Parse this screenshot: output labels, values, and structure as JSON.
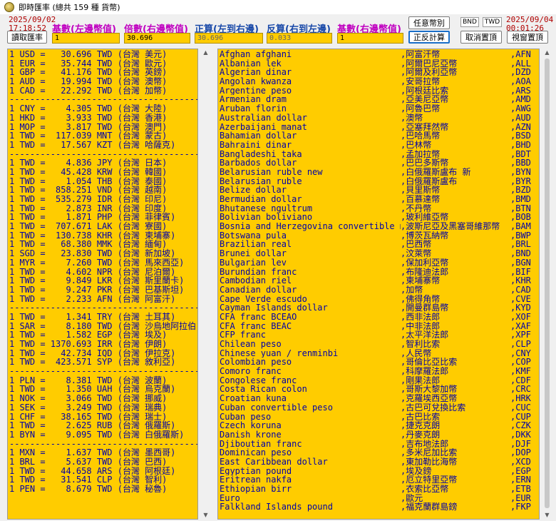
{
  "window": {
    "title": "即時匯率 (總共 159 種 貨幣)"
  },
  "timestamps": {
    "left_date": "2025/09/02",
    "left_time": "17:18:52",
    "right_date": "2025/09/04",
    "right_time": "00:01:26"
  },
  "labels": {
    "base_left": "基數(左邊幣值)",
    "multiplier_right": "倍數(右邊幣值)",
    "forward_calc": "正算(左到右邊)",
    "reverse_calc": "反算(右到左邊)",
    "base_right": "基數(右邊幣值)"
  },
  "inputs": {
    "base_left": "1",
    "multiplier_right": "30.696",
    "forward_calc": "30.696",
    "reverse_calc": "0.033",
    "base_right": "1"
  },
  "buttons": {
    "read_rates": "讀取匯率",
    "any_currency": "任意幣別",
    "swap_calc": "正反計算",
    "unpin": "取消置頂",
    "pin": "視窗置頂"
  },
  "currency_pair": {
    "left": "BND",
    "right": "TWD"
  },
  "left_list": [
    "1 USD =   30.696 TWD (台灣 美元)",
    "1 EUR =   35.744 TWD (台灣 歐元)",
    "1 GBP =   41.176 TWD (台灣 英鎊)",
    "1 AUD =   19.994 TWD (台灣 澳幣)",
    "1 CAD =   22.292 TWD (台灣 加幣)",
    "------------------------------------------",
    "1 CNY =    4.305 TWD (台灣 大陸)",
    "1 HKD =    3.933 TWD (台灣 香港)",
    "1 MOP =    3.817 TWD (台灣 澳門)",
    "1 TWD =  117.039 MNT (台灣 蒙古)",
    "1 TWD =   17.567 KZT (台灣 哈薩克)",
    "------------------------------------------",
    "1 TWD =    4.836 JPY (台灣 日本)",
    "1 TWD =   45.428 KRW (台灣 韓國)",
    "1 TWD =    1.054 THB (台灣 泰國)",
    "1 TWD =  858.251 VND (台灣 越南)",
    "1 TWD =  535.279 IDR (台灣 印尼)",
    "1 TWD =    2.873 INR (台灣 印度)",
    "1 TWD =    1.871 PHP (台灣 菲律賓)",
    "1 TWD =  707.671 LAK (台灣 寮國)",
    "1 TWD =  130.738 KHR (台灣 柬埔寨)",
    "1 TWD =   68.380 MMK (台灣 緬甸)",
    "1 SGD =   23.830 TWD (台灣 新加坡)",
    "1 MYR =    7.260 TWD (台灣 馬來西亞)",
    "1 TWD =    4.602 NPR (台灣 尼泊爾)",
    "1 TWD =    9.849 LKR (台灣 斯里蘭卡)",
    "1 TWD =    9.247 PKR (台灣 巴基斯坦)",
    "1 TWD =    2.233 AFN (台灣 阿富汗)",
    "------------------------------------------",
    "1 TWD =    1.341 TRY (台灣 土耳其)",
    "1 SAR =    8.180 TWD (台灣 沙烏地阿拉伯)",
    "1 TWD =    1.582 EGP (台灣 埃及)",
    "1 TWD = 1370.693 IRR (台灣 伊朗)",
    "1 TWD =   42.734 IQD (台灣 伊拉克)",
    "1 TWD =  423.571 SYP (台灣 敘利亞)",
    "------------------------------------------",
    "1 PLN =    8.381 TWD (台灣 波蘭)",
    "1 TWD =    1.350 UAH (台灣 烏克蘭)",
    "1 NOK =    3.066 TWD (台灣 挪威)",
    "1 SEK =    3.249 TWD (台灣 瑞典)",
    "1 CHF =   38.165 TWD (台灣 瑞士)",
    "1 TWD =    2.625 RUB (台灣 俄羅斯)",
    "1 BYN =    9.095 TWD (台灣 白俄羅斯)",
    "------------------------------------------",
    "1 MXN =    1.637 TWD (台灣 墨西哥)",
    "1 BRL =    5.637 TWD (台灣 巴西)",
    "1 TWD =   44.658 ARS (台灣 阿根廷)",
    "1 TWD =   31.541 CLP (台灣 智利)",
    "1 PEN =    8.679 TWD (台灣 秘魯)"
  ],
  "right_list": [
    [
      "Afghan afghani",
      ",阿富汗幣",
      ",AFN"
    ],
    [
      "Albanian lek",
      ",阿爾巴尼亞幣",
      ",ALL"
    ],
    [
      "Algerian dinar",
      ",阿爾及利亞幣",
      ",DZD"
    ],
    [
      "Angolan kwanza",
      ",安哥拉幣",
      ",AOA"
    ],
    [
      "Argentine peso",
      ",阿根廷比索",
      ",ARS"
    ],
    [
      "Armenian dram",
      ",亞美尼亞幣",
      ",AMD"
    ],
    [
      "Aruban florin",
      ",阿魯巴幣",
      ",AWG"
    ],
    [
      "Australian dollar",
      ",澳幣",
      ",AUD"
    ],
    [
      "Azerbaijani manat",
      ",亞塞拜然幣",
      ",AZN"
    ],
    [
      "Bahamian dollar",
      ",巴哈馬幣",
      ",BSD"
    ],
    [
      "Bahraini dinar",
      ",巴林幣",
      ",BHD"
    ],
    [
      "Bangladeshi taka",
      ",孟加拉幣",
      ",BDT"
    ],
    [
      "Barbados dollar",
      ",巴巴多斯幣",
      ",BBD"
    ],
    [
      "Belarusian ruble new",
      ",白俄羅斯盧布 新",
      ",BYN"
    ],
    [
      "Belarusian ruble",
      ",白俄羅斯盧布",
      ",BYR"
    ],
    [
      "Belize dollar",
      ",貝里斯幣",
      ",BZD"
    ],
    [
      "Bermudian dollar",
      ",百慕達幣",
      ",BMD"
    ],
    [
      "Bhutanese ngultrum",
      ",不丹幣",
      ",BTN"
    ],
    [
      "Bolivian boliviano",
      ",玻利維亞幣",
      ",BOB"
    ],
    [
      "Bosnia and Herzegovina convertible mark",
      ",波斯尼亞及黑塞哥維那幣",
      ",BAM"
    ],
    [
      "Botswana pula",
      ",博茨瓦納幣",
      ",BWP"
    ],
    [
      "Brazilian real",
      ",巴西幣",
      ",BRL"
    ],
    [
      "Brunei dollar",
      ",汶萊幣",
      ",BND"
    ],
    [
      "Bulgarian lev",
      ",保加利亞幣",
      ",BGN"
    ],
    [
      "Burundian franc",
      ",布隆迪法郎",
      ",BIF"
    ],
    [
      "Cambodian riel",
      ",柬埔寨幣",
      ",KHR"
    ],
    [
      "Canadian dollar",
      ",加幣",
      ",CAD"
    ],
    [
      "Cape Verde escudo",
      ",佛得角幣",
      ",CVE"
    ],
    [
      "Cayman Islands dollar",
      ",開曼群島幣",
      ",KYD"
    ],
    [
      "CFA franc BCEAO",
      ",西非法郎",
      ",XOF"
    ],
    [
      "CFA franc BEAC",
      ",中非法郎",
      ",XAF"
    ],
    [
      "CFP franc",
      ",太平洋法郎",
      ",XPF"
    ],
    [
      "Chilean peso",
      ",智利比索",
      ",CLP"
    ],
    [
      "Chinese yuan / renminbi",
      ",人民幣",
      ",CNY"
    ],
    [
      "Colombian peso",
      ",哥倫比亞比索",
      ",COP"
    ],
    [
      "Comoro franc",
      ",科摩羅法郎",
      ",KMF"
    ],
    [
      "Congolese franc",
      ",剛果法郎",
      ",CDF"
    ],
    [
      "Costa Rican colon",
      ",哥斯大黎加幣",
      ",CRC"
    ],
    [
      "Croatian kuna",
      ",克羅埃西亞幣",
      ",HRK"
    ],
    [
      "Cuban convertible peso",
      ",古巴可兌換比索",
      ",CUC"
    ],
    [
      "Cuban peso",
      ",古巴比索",
      ",CUP"
    ],
    [
      "Czech koruna",
      ",捷克克朗",
      ",CZK"
    ],
    [
      "Danish krone",
      ",丹麥克朗",
      ",DKK"
    ],
    [
      "Djiboutian franc",
      ",吉布地法郎",
      ",DJF"
    ],
    [
      "Dominican peso",
      ",多米尼加比索",
      ",DOP"
    ],
    [
      "East Caribbean dollar",
      ",東加勒比海幣",
      ",XCD"
    ],
    [
      "Egyptian pound",
      ",埃及鎊",
      ",EGP"
    ],
    [
      "Eritrean nakfa",
      ",厄立特里亞幣",
      ",ERN"
    ],
    [
      "Ethiopian birr",
      ",衣索比亞幣",
      ",ETB"
    ],
    [
      "Euro",
      ",歐元",
      ",EUR"
    ],
    [
      "Falkland Islands pound",
      ",福克蘭群島鎊",
      ",FKP"
    ]
  ]
}
